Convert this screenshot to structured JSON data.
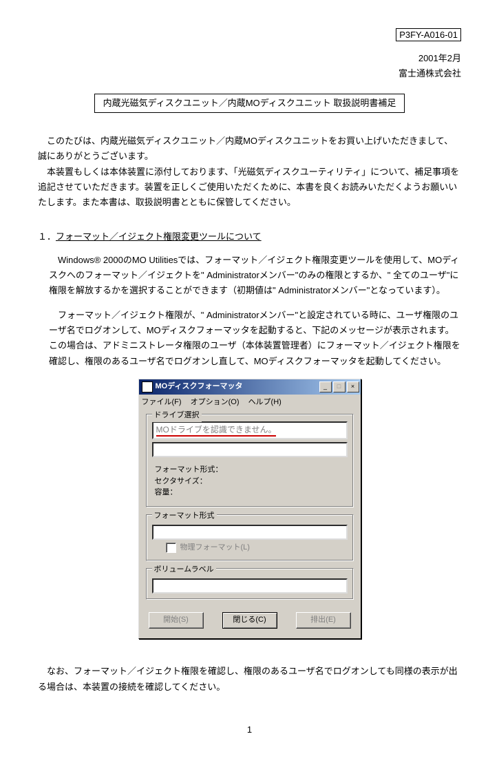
{
  "doc_id": "P3FY-A016-01",
  "date": "2001年2月",
  "company": "富士通株式会社",
  "title": "内蔵光磁気ディスクユニット／内蔵MOディスクユニット 取扱説明書補足",
  "intro": {
    "p1": "このたびは、内蔵光磁気ディスクユニット／内蔵MOディスクユニットをお買い上げいただきまして、誠にありがとうございます。",
    "p2": "本装置もしくは本体装置に添付しております、「光磁気ディスクユーティリティ」について、補足事項を追記させていただきます。装置を正しくご使用いただくために、本書を良くお読みいただくようお願いいたします。また本書は、取扱説明書とともに保管してください。"
  },
  "section1": {
    "number": "１．",
    "heading": "フォーマット／イジェクト権限変更ツールについて",
    "p1": "Windows® 2000のMO Utilitiesでは、フォーマット／イジェクト権限変更ツールを使用して、MOディスクへのフォーマット／イジェクトを\" Administratorメンバー\"のみの権限とするか、\" 全てのユーザ\"に権限を解放するかを選択することができます（初期値は\" Administratorメンバー\"となっています）。",
    "p2": "フォーマット／イジェクト権限が、\" Administratorメンバー\"と設定されている時に、ユーザ権限のユーザ名でログオンして、MOディスクフォーマッタを起動すると、下記のメッセージが表示されます。この場合は、アドミニストレータ権限のユーザ（本体装置管理者）にフォーマット／イジェクト権限を確認し、権限のあるユーザ名でログオンし直して、MOディスクフォーマッタを起動してください。"
  },
  "dialog": {
    "title": "MOディスクフォーマッタ",
    "menu": {
      "file": "ファイル(F)",
      "option": "オプション(O)",
      "help": "ヘルプ(H)"
    },
    "group_drive": "ドライブ選択",
    "drive_message": "MOドライブを認識できません。",
    "label_format_type": "フォーマット形式：",
    "label_sector_size": "セクタサイズ：",
    "label_capacity": "容量：",
    "group_format": "フォーマット形式",
    "chk_physical": "物理フォーマット(L)",
    "group_volume": "ボリュームラベル",
    "btn_start": "開始(S)",
    "btn_close": "閉じる(C)",
    "btn_eject": "排出(E)"
  },
  "closing": {
    "p1": "なお、フォーマット／イジェクト権限を確認し、権限のあるユーザ名でログオンしても同様の表示が出る場合は、本装置の接続を確認してください。"
  },
  "page_number": "1"
}
